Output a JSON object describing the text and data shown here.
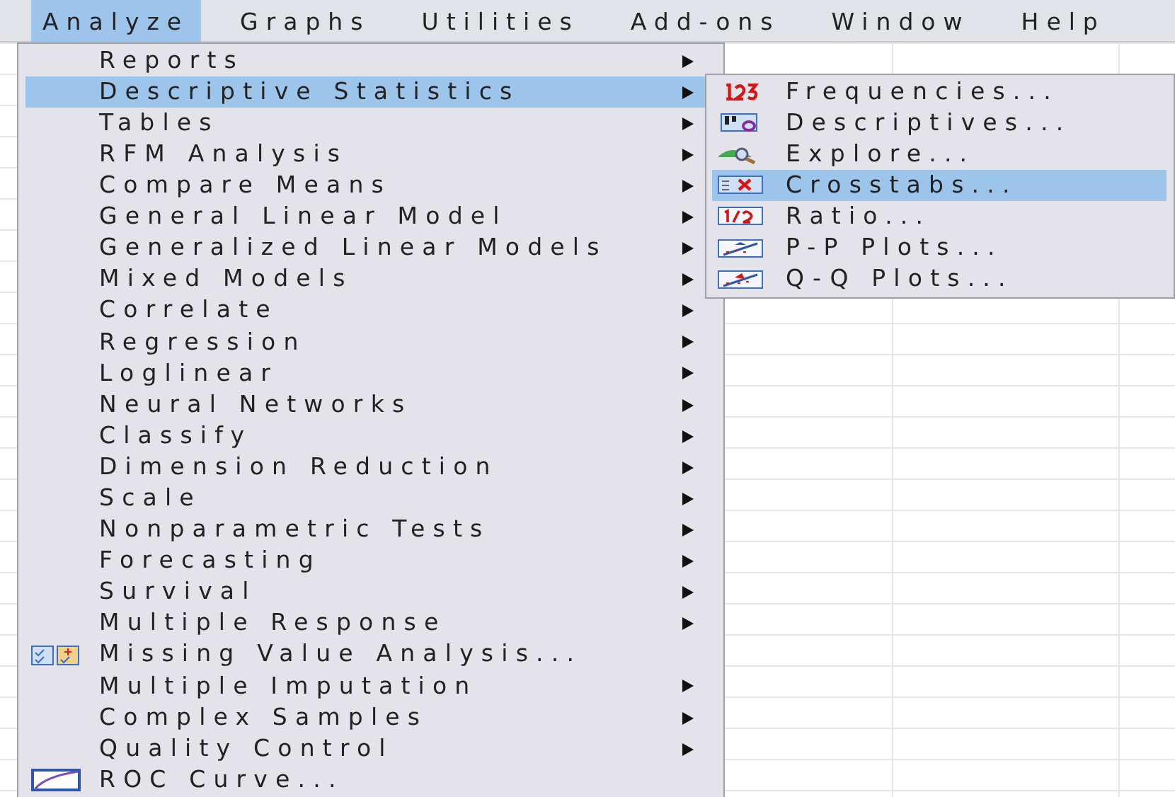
{
  "menubar": [
    {
      "label": "Analyze",
      "selected": true
    },
    {
      "label": "Graphs",
      "selected": false
    },
    {
      "label": "Utilities",
      "selected": false
    },
    {
      "label": "Add-ons",
      "selected": false
    },
    {
      "label": "Window",
      "selected": false
    },
    {
      "label": "Help",
      "selected": false
    }
  ],
  "analyze_menu": [
    {
      "label": "Reports",
      "kind": "plain",
      "has_submenu": true,
      "selected": false
    },
    {
      "label": "Descriptive Statistics",
      "kind": "plain",
      "has_submenu": true,
      "selected": true
    },
    {
      "label": "Tables",
      "kind": "plain",
      "has_submenu": true,
      "selected": false
    },
    {
      "label": "RFM Analysis",
      "kind": "plain",
      "has_submenu": true,
      "selected": false
    },
    {
      "label": "Compare Means",
      "kind": "plain",
      "has_submenu": true,
      "selected": false
    },
    {
      "label": "General Linear Model",
      "kind": "plain",
      "has_submenu": true,
      "selected": false
    },
    {
      "label": "Generalized Linear Models",
      "kind": "plain",
      "has_submenu": true,
      "selected": false
    },
    {
      "label": "Mixed Models",
      "kind": "plain",
      "has_submenu": true,
      "selected": false
    },
    {
      "label": "Correlate",
      "kind": "plain",
      "has_submenu": true,
      "selected": false
    },
    {
      "label": "Regression",
      "kind": "plain",
      "has_submenu": true,
      "selected": false
    },
    {
      "label": "Loglinear",
      "kind": "plain",
      "has_submenu": true,
      "selected": false
    },
    {
      "label": "Neural Networks",
      "kind": "plain",
      "has_submenu": true,
      "selected": false
    },
    {
      "label": "Classify",
      "kind": "plain",
      "has_submenu": true,
      "selected": false
    },
    {
      "label": "Dimension Reduction",
      "kind": "plain",
      "has_submenu": true,
      "selected": false
    },
    {
      "label": "Scale",
      "kind": "plain",
      "has_submenu": true,
      "selected": false
    },
    {
      "label": "Nonparametric Tests",
      "kind": "plain",
      "has_submenu": true,
      "selected": false
    },
    {
      "label": "Forecasting",
      "kind": "plain",
      "has_submenu": true,
      "selected": false
    },
    {
      "label": "Survival",
      "kind": "plain",
      "has_submenu": true,
      "selected": false
    },
    {
      "label": "Multiple Response",
      "kind": "plain",
      "has_submenu": true,
      "selected": false
    },
    {
      "label": "Missing Value Analysis...",
      "kind": "missing-values",
      "has_submenu": false,
      "selected": false
    },
    {
      "label": "Multiple Imputation",
      "kind": "plain",
      "has_submenu": true,
      "selected": false
    },
    {
      "label": "Complex Samples",
      "kind": "plain",
      "has_submenu": true,
      "selected": false
    },
    {
      "label": "Quality Control",
      "kind": "plain",
      "has_submenu": true,
      "selected": false
    },
    {
      "label": "ROC Curve...",
      "kind": "roc",
      "has_submenu": false,
      "selected": false
    }
  ],
  "descriptive_statistics_menu": [
    {
      "label": "Frequencies...",
      "kind": "frequencies",
      "selected": false
    },
    {
      "label": "Descriptives...",
      "kind": "descriptives",
      "selected": false
    },
    {
      "label": "Explore...",
      "kind": "explore",
      "selected": false
    },
    {
      "label": "Crosstabs...",
      "kind": "crosstabs",
      "selected": true
    },
    {
      "label": "Ratio...",
      "kind": "ratio",
      "selected": false
    },
    {
      "label": "P-P Plots...",
      "kind": "pp-plots",
      "selected": false
    },
    {
      "label": "Q-Q Plots...",
      "kind": "qq-plots",
      "selected": false
    }
  ]
}
